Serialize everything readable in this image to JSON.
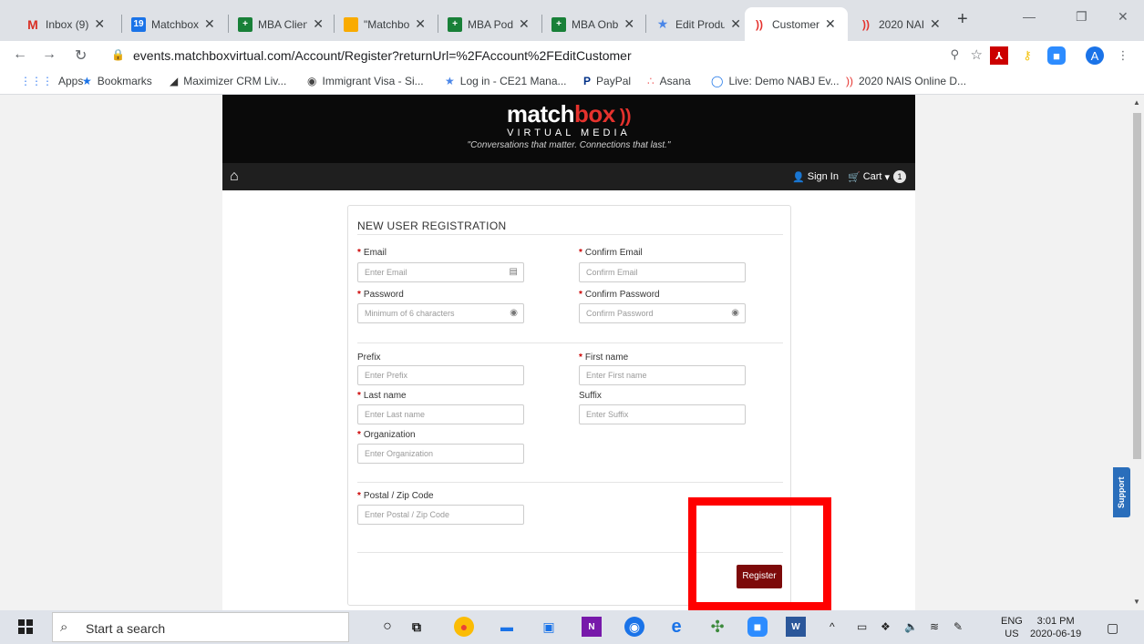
{
  "browser": {
    "tabs": [
      {
        "label": "Inbox (9)",
        "icon_text": "M",
        "icon_color": "#ffffff",
        "icon_fg": "#d93025"
      },
      {
        "label": "Matchbox",
        "icon_text": "19",
        "icon_color": "#1a73e8",
        "icon_fg": "#ffffff"
      },
      {
        "label": "MBA Clien",
        "icon_text": "+",
        "icon_color": "#188038",
        "icon_fg": "#ffffff"
      },
      {
        "label": "\"Matchbo",
        "icon_text": "",
        "icon_color": "#f9ab00",
        "icon_fg": "#ffffff"
      },
      {
        "label": "MBA Pod",
        "icon_text": "+",
        "icon_color": "#188038",
        "icon_fg": "#ffffff"
      },
      {
        "label": "MBA Onb",
        "icon_text": "+",
        "icon_color": "#188038",
        "icon_fg": "#ffffff"
      },
      {
        "label": "Edit Produ",
        "icon_text": "★",
        "icon_color": "#ffffff",
        "icon_fg": "#4a86e8"
      },
      {
        "label": "Customer",
        "icon_text": "))",
        "icon_color": "#ffffff",
        "icon_fg": "#e5322d"
      },
      {
        "label": "2020 NAI",
        "icon_text": "))",
        "icon_color": "#ffffff",
        "icon_fg": "#e5322d"
      }
    ],
    "new_tab": "+",
    "url": "events.matchboxvirtual.com/Account/Register?returnUrl=%2FAccount%2FEditCustomer",
    "profile_letter": "A",
    "bookmarks": [
      {
        "label": "Apps",
        "icon": "⋮⋮⋮"
      },
      {
        "label": "Bookmarks",
        "icon": "★"
      },
      {
        "label": "Maximizer CRM Liv...",
        "icon": "◢"
      },
      {
        "label": "Immigrant Visa - Si...",
        "icon": "◉"
      },
      {
        "label": "Log in - CE21 Mana...",
        "icon": "★"
      },
      {
        "label": "PayPal",
        "icon": "P"
      },
      {
        "label": "Asana",
        "icon": "∴"
      },
      {
        "label": "Live: Demo NABJ Ev...",
        "icon": "◯"
      },
      {
        "label": "2020 NAIS Online D...",
        "icon": "))"
      }
    ]
  },
  "site": {
    "logo_main": "match",
    "logo_box": "box",
    "logo_sub": "VIRTUAL MEDIA",
    "tagline": "\"Conversations that matter. Connections that last.\"",
    "nav": {
      "sign_in": "Sign In",
      "cart": "Cart",
      "cart_count": "1"
    }
  },
  "form": {
    "title": "NEW USER REGISTRATION",
    "email_label": "Email",
    "email_placeholder": "Enter Email",
    "confirm_email_label": "Confirm Email",
    "confirm_email_placeholder": "Confirm Email",
    "password_label": "Password",
    "password_placeholder": "Minimum of 6 characters",
    "confirm_password_label": "Confirm Password",
    "confirm_password_placeholder": "Confirm Password",
    "prefix_label": "Prefix",
    "prefix_placeholder": "Enter Prefix",
    "first_name_label": "First name",
    "first_name_placeholder": "Enter First name",
    "last_name_label": "Last name",
    "last_name_placeholder": "Enter Last name",
    "suffix_label": "Suffix",
    "suffix_placeholder": "Enter Suffix",
    "organization_label": "Organization",
    "organization_placeholder": "Enter Organization",
    "postal_label": "Postal / Zip Code",
    "postal_placeholder": "Enter Postal / Zip Code",
    "register_button": "Register"
  },
  "support_tab": "Support",
  "taskbar": {
    "search_text": "Start a search",
    "lang_top": "ENG",
    "lang_bottom": "US",
    "time": "3:01 PM",
    "date": "2020-06-19"
  },
  "colors": {
    "accent_red": "#e5322d",
    "register_btn": "#7d0a0a",
    "highlight": "#ff0000",
    "support": "#2a6ebb"
  }
}
